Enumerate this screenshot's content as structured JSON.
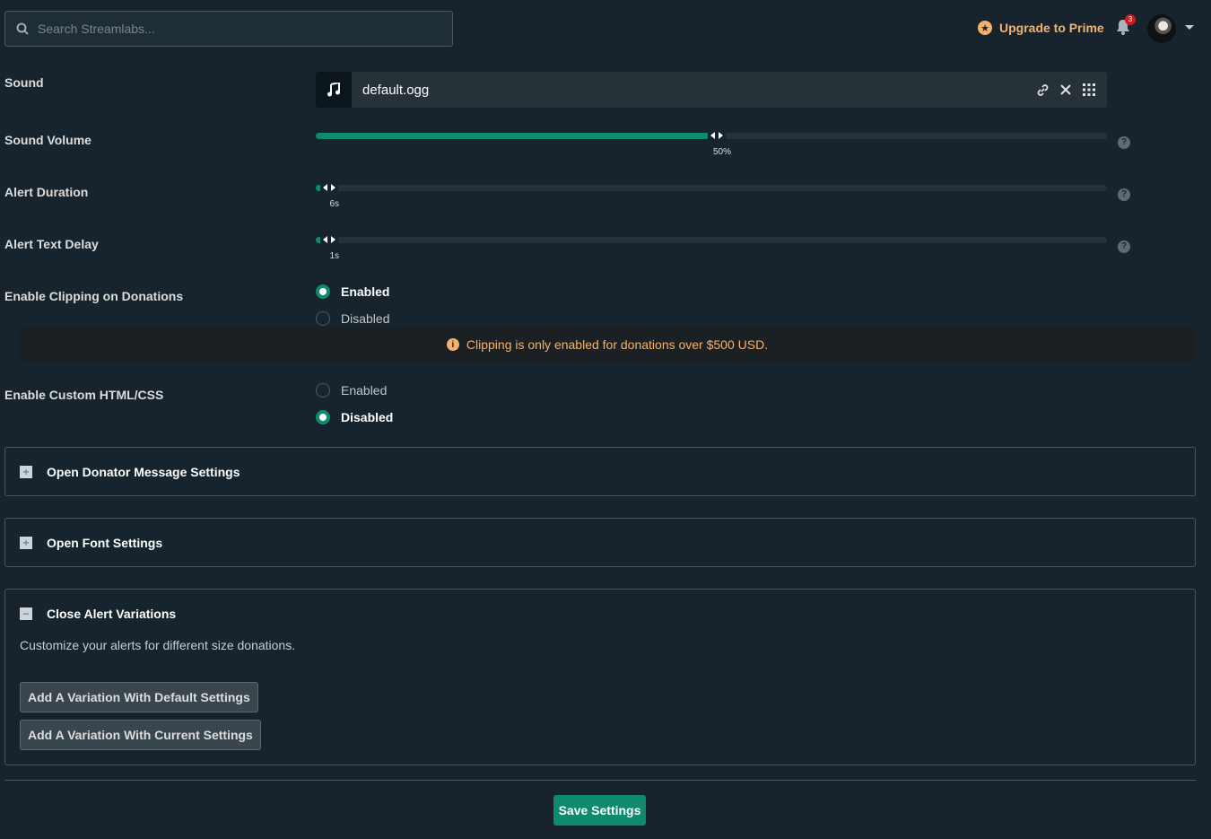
{
  "search": {
    "placeholder": "Search Streamlabs..."
  },
  "header": {
    "upgrade_label": "Upgrade to Prime",
    "notification_count": "3"
  },
  "sound": {
    "label": "Sound",
    "file_name": "default.ogg"
  },
  "sound_volume": {
    "label": "Sound Volume",
    "value_text": "50%",
    "fraction": 0.5
  },
  "alert_duration": {
    "label": "Alert Duration",
    "value_text": "6s",
    "fraction": 0.01
  },
  "alert_text_delay": {
    "label": "Alert Text Delay",
    "value_text": "1s",
    "fraction": 0.01
  },
  "clipping": {
    "label": "Enable Clipping on Donations",
    "options": [
      "Enabled",
      "Disabled"
    ],
    "selected": "Enabled",
    "notice": "Clipping is only enabled for donations over $500 USD."
  },
  "custom_html": {
    "label": "Enable Custom HTML/CSS",
    "options": [
      "Enabled",
      "Disabled"
    ],
    "selected": "Disabled"
  },
  "panels": {
    "donator_message": {
      "label": "Open Donator Message Settings"
    },
    "font": {
      "label": "Open Font Settings"
    },
    "alert_variations": {
      "label": "Close Alert Variations",
      "description": "Customize your alerts for different size donations.",
      "add_default_label": "Add A Variation With Default Settings",
      "add_current_label": "Add A Variation With Current Settings"
    }
  },
  "save_label": "Save Settings",
  "colors": {
    "accent": "#0f8a6d",
    "warning": "#f6b26b",
    "background": "#17242d"
  }
}
